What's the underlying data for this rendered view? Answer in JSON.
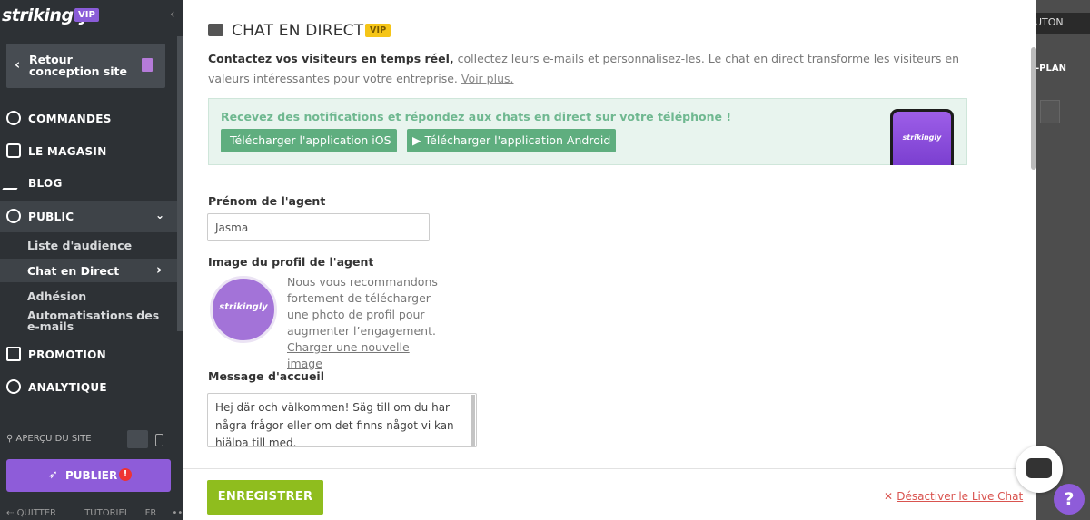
{
  "sidebar": {
    "logo": "strikingly",
    "logo_badge": "VIP",
    "back_label": "Retour conception site",
    "nav": {
      "commandes": "COMMANDES",
      "magasin": "LE MAGASIN",
      "blog": "BLOG",
      "public": "PUBLIC",
      "promotion": "PROMOTION",
      "analytique": "ANALYTIQUE"
    },
    "public_sub": {
      "audience": "Liste d'audience",
      "chat": "Chat en Direct",
      "adhesion": "Adhésion",
      "automations": "Automatisations des e-mails"
    },
    "preview": "APERÇU DU SITE",
    "publish": "PUBLIER",
    "footer": {
      "quit": "QUITTER",
      "tutorial": "TUTORIEL",
      "lang": "FR",
      "more": "•••"
    }
  },
  "background": {
    "button1": "UTON",
    "button2": "-PLAN"
  },
  "modal": {
    "title": "CHAT EN DIRECT",
    "title_badge": "VIP",
    "desc_bold": "Contactez vos visiteurs en temps réel,",
    "desc_rest": " collectez leurs e-mails et personnalisez-les. Le chat en direct transforme les visiteurs en valeurs intéressantes pour votre entreprise. ",
    "desc_link": "Voir plus.",
    "notif_heading": "Recevez des notifications et répondez aux chats en direct sur votre téléphone !",
    "ios_button": "Télécharger l'application iOS",
    "android_button": "Télécharger l'application Android",
    "phone_logo": "strikingly",
    "agent_name_label": "Prénom de l'agent",
    "agent_name_value": "Jasma",
    "profile_label": "Image du profil de l'agent",
    "avatar_logo": "strikingly",
    "profile_note": "Nous vous recommandons fortement de télécharger une photo de profil pour augmenter l’engagement.",
    "profile_link": "Charger une nouvelle image",
    "welcome_label": "Message d'accueil",
    "welcome_value": "Hej där och välkommen! Säg till om du har några frågor eller om det finns något vi kan hjälpa till med.",
    "save_button": "ENREGISTRER",
    "deactivate_link": "Désactiver le Live Chat"
  },
  "help_label": "?",
  "colors": {
    "brand_purple": "#8e5cd9",
    "save_green": "#8fbd1e",
    "notif_green": "#5fae7f",
    "danger": "#d9534f"
  }
}
